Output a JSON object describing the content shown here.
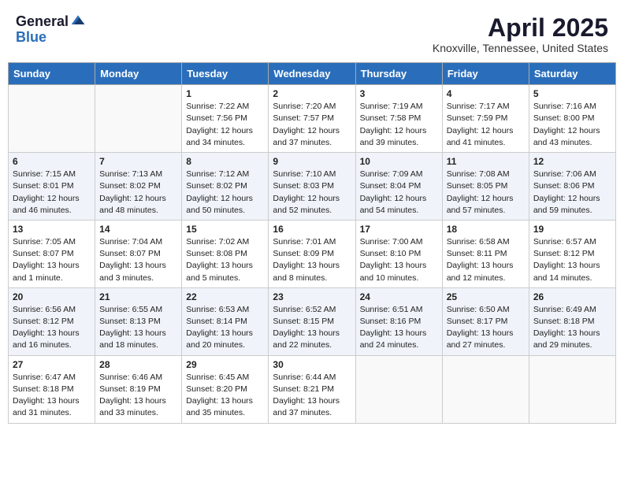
{
  "header": {
    "logo_general": "General",
    "logo_blue": "Blue",
    "month_title": "April 2025",
    "location": "Knoxville, Tennessee, United States"
  },
  "weekdays": [
    "Sunday",
    "Monday",
    "Tuesday",
    "Wednesday",
    "Thursday",
    "Friday",
    "Saturday"
  ],
  "weeks": [
    [
      {
        "day": "",
        "info": ""
      },
      {
        "day": "",
        "info": ""
      },
      {
        "day": "1",
        "info": "Sunrise: 7:22 AM\nSunset: 7:56 PM\nDaylight: 12 hours and 34 minutes."
      },
      {
        "day": "2",
        "info": "Sunrise: 7:20 AM\nSunset: 7:57 PM\nDaylight: 12 hours and 37 minutes."
      },
      {
        "day": "3",
        "info": "Sunrise: 7:19 AM\nSunset: 7:58 PM\nDaylight: 12 hours and 39 minutes."
      },
      {
        "day": "4",
        "info": "Sunrise: 7:17 AM\nSunset: 7:59 PM\nDaylight: 12 hours and 41 minutes."
      },
      {
        "day": "5",
        "info": "Sunrise: 7:16 AM\nSunset: 8:00 PM\nDaylight: 12 hours and 43 minutes."
      }
    ],
    [
      {
        "day": "6",
        "info": "Sunrise: 7:15 AM\nSunset: 8:01 PM\nDaylight: 12 hours and 46 minutes."
      },
      {
        "day": "7",
        "info": "Sunrise: 7:13 AM\nSunset: 8:02 PM\nDaylight: 12 hours and 48 minutes."
      },
      {
        "day": "8",
        "info": "Sunrise: 7:12 AM\nSunset: 8:02 PM\nDaylight: 12 hours and 50 minutes."
      },
      {
        "day": "9",
        "info": "Sunrise: 7:10 AM\nSunset: 8:03 PM\nDaylight: 12 hours and 52 minutes."
      },
      {
        "day": "10",
        "info": "Sunrise: 7:09 AM\nSunset: 8:04 PM\nDaylight: 12 hours and 54 minutes."
      },
      {
        "day": "11",
        "info": "Sunrise: 7:08 AM\nSunset: 8:05 PM\nDaylight: 12 hours and 57 minutes."
      },
      {
        "day": "12",
        "info": "Sunrise: 7:06 AM\nSunset: 8:06 PM\nDaylight: 12 hours and 59 minutes."
      }
    ],
    [
      {
        "day": "13",
        "info": "Sunrise: 7:05 AM\nSunset: 8:07 PM\nDaylight: 13 hours and 1 minute."
      },
      {
        "day": "14",
        "info": "Sunrise: 7:04 AM\nSunset: 8:07 PM\nDaylight: 13 hours and 3 minutes."
      },
      {
        "day": "15",
        "info": "Sunrise: 7:02 AM\nSunset: 8:08 PM\nDaylight: 13 hours and 5 minutes."
      },
      {
        "day": "16",
        "info": "Sunrise: 7:01 AM\nSunset: 8:09 PM\nDaylight: 13 hours and 8 minutes."
      },
      {
        "day": "17",
        "info": "Sunrise: 7:00 AM\nSunset: 8:10 PM\nDaylight: 13 hours and 10 minutes."
      },
      {
        "day": "18",
        "info": "Sunrise: 6:58 AM\nSunset: 8:11 PM\nDaylight: 13 hours and 12 minutes."
      },
      {
        "day": "19",
        "info": "Sunrise: 6:57 AM\nSunset: 8:12 PM\nDaylight: 13 hours and 14 minutes."
      }
    ],
    [
      {
        "day": "20",
        "info": "Sunrise: 6:56 AM\nSunset: 8:12 PM\nDaylight: 13 hours and 16 minutes."
      },
      {
        "day": "21",
        "info": "Sunrise: 6:55 AM\nSunset: 8:13 PM\nDaylight: 13 hours and 18 minutes."
      },
      {
        "day": "22",
        "info": "Sunrise: 6:53 AM\nSunset: 8:14 PM\nDaylight: 13 hours and 20 minutes."
      },
      {
        "day": "23",
        "info": "Sunrise: 6:52 AM\nSunset: 8:15 PM\nDaylight: 13 hours and 22 minutes."
      },
      {
        "day": "24",
        "info": "Sunrise: 6:51 AM\nSunset: 8:16 PM\nDaylight: 13 hours and 24 minutes."
      },
      {
        "day": "25",
        "info": "Sunrise: 6:50 AM\nSunset: 8:17 PM\nDaylight: 13 hours and 27 minutes."
      },
      {
        "day": "26",
        "info": "Sunrise: 6:49 AM\nSunset: 8:18 PM\nDaylight: 13 hours and 29 minutes."
      }
    ],
    [
      {
        "day": "27",
        "info": "Sunrise: 6:47 AM\nSunset: 8:18 PM\nDaylight: 13 hours and 31 minutes."
      },
      {
        "day": "28",
        "info": "Sunrise: 6:46 AM\nSunset: 8:19 PM\nDaylight: 13 hours and 33 minutes."
      },
      {
        "day": "29",
        "info": "Sunrise: 6:45 AM\nSunset: 8:20 PM\nDaylight: 13 hours and 35 minutes."
      },
      {
        "day": "30",
        "info": "Sunrise: 6:44 AM\nSunset: 8:21 PM\nDaylight: 13 hours and 37 minutes."
      },
      {
        "day": "",
        "info": ""
      },
      {
        "day": "",
        "info": ""
      },
      {
        "day": "",
        "info": ""
      }
    ]
  ]
}
